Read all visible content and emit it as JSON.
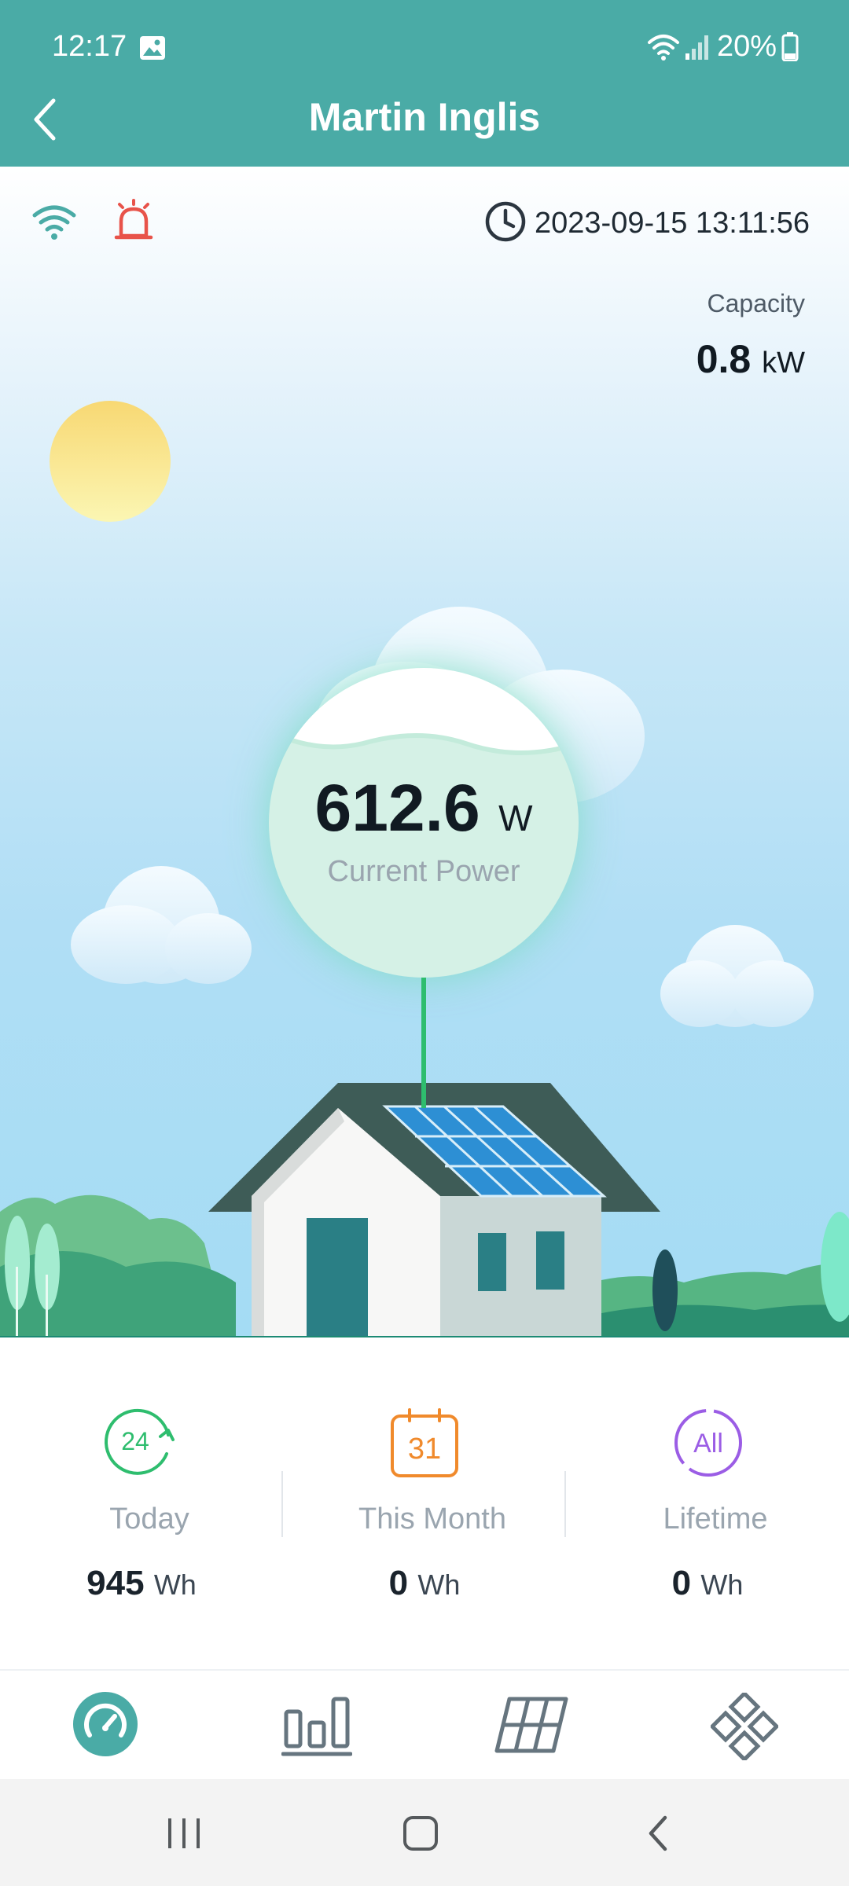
{
  "status_bar": {
    "time": "12:17",
    "battery": "20%"
  },
  "header": {
    "title": "Martin Inglis"
  },
  "scene": {
    "timestamp": "2023-09-15 13:11:56",
    "capacity": {
      "label": "Capacity",
      "value": "0.8",
      "unit": "kW"
    },
    "power": {
      "value": "612.6",
      "unit": "W",
      "label": "Current Power"
    }
  },
  "stats": [
    {
      "icon": "24",
      "label": "Today",
      "value": "945",
      "unit": "Wh"
    },
    {
      "icon": "31",
      "label": "This Month",
      "value": "0",
      "unit": "Wh"
    },
    {
      "icon": "All",
      "label": "Lifetime",
      "value": "0",
      "unit": "Wh"
    }
  ],
  "colors": {
    "header": "#4aaba6",
    "accent_green": "#2ebd6e",
    "alarm_red": "#e8534a",
    "month_orange": "#f08a2c",
    "lifetime_purple": "#9b5de5"
  },
  "icons": {
    "status": [
      "image-icon",
      "wifi-icon",
      "signal-icon",
      "battery-icon"
    ],
    "nav": [
      "dashboard-icon",
      "bar-chart-icon",
      "solar-panel-icon",
      "devices-icon"
    ],
    "system_nav": [
      "recent-apps-icon",
      "home-icon",
      "back-icon"
    ]
  }
}
